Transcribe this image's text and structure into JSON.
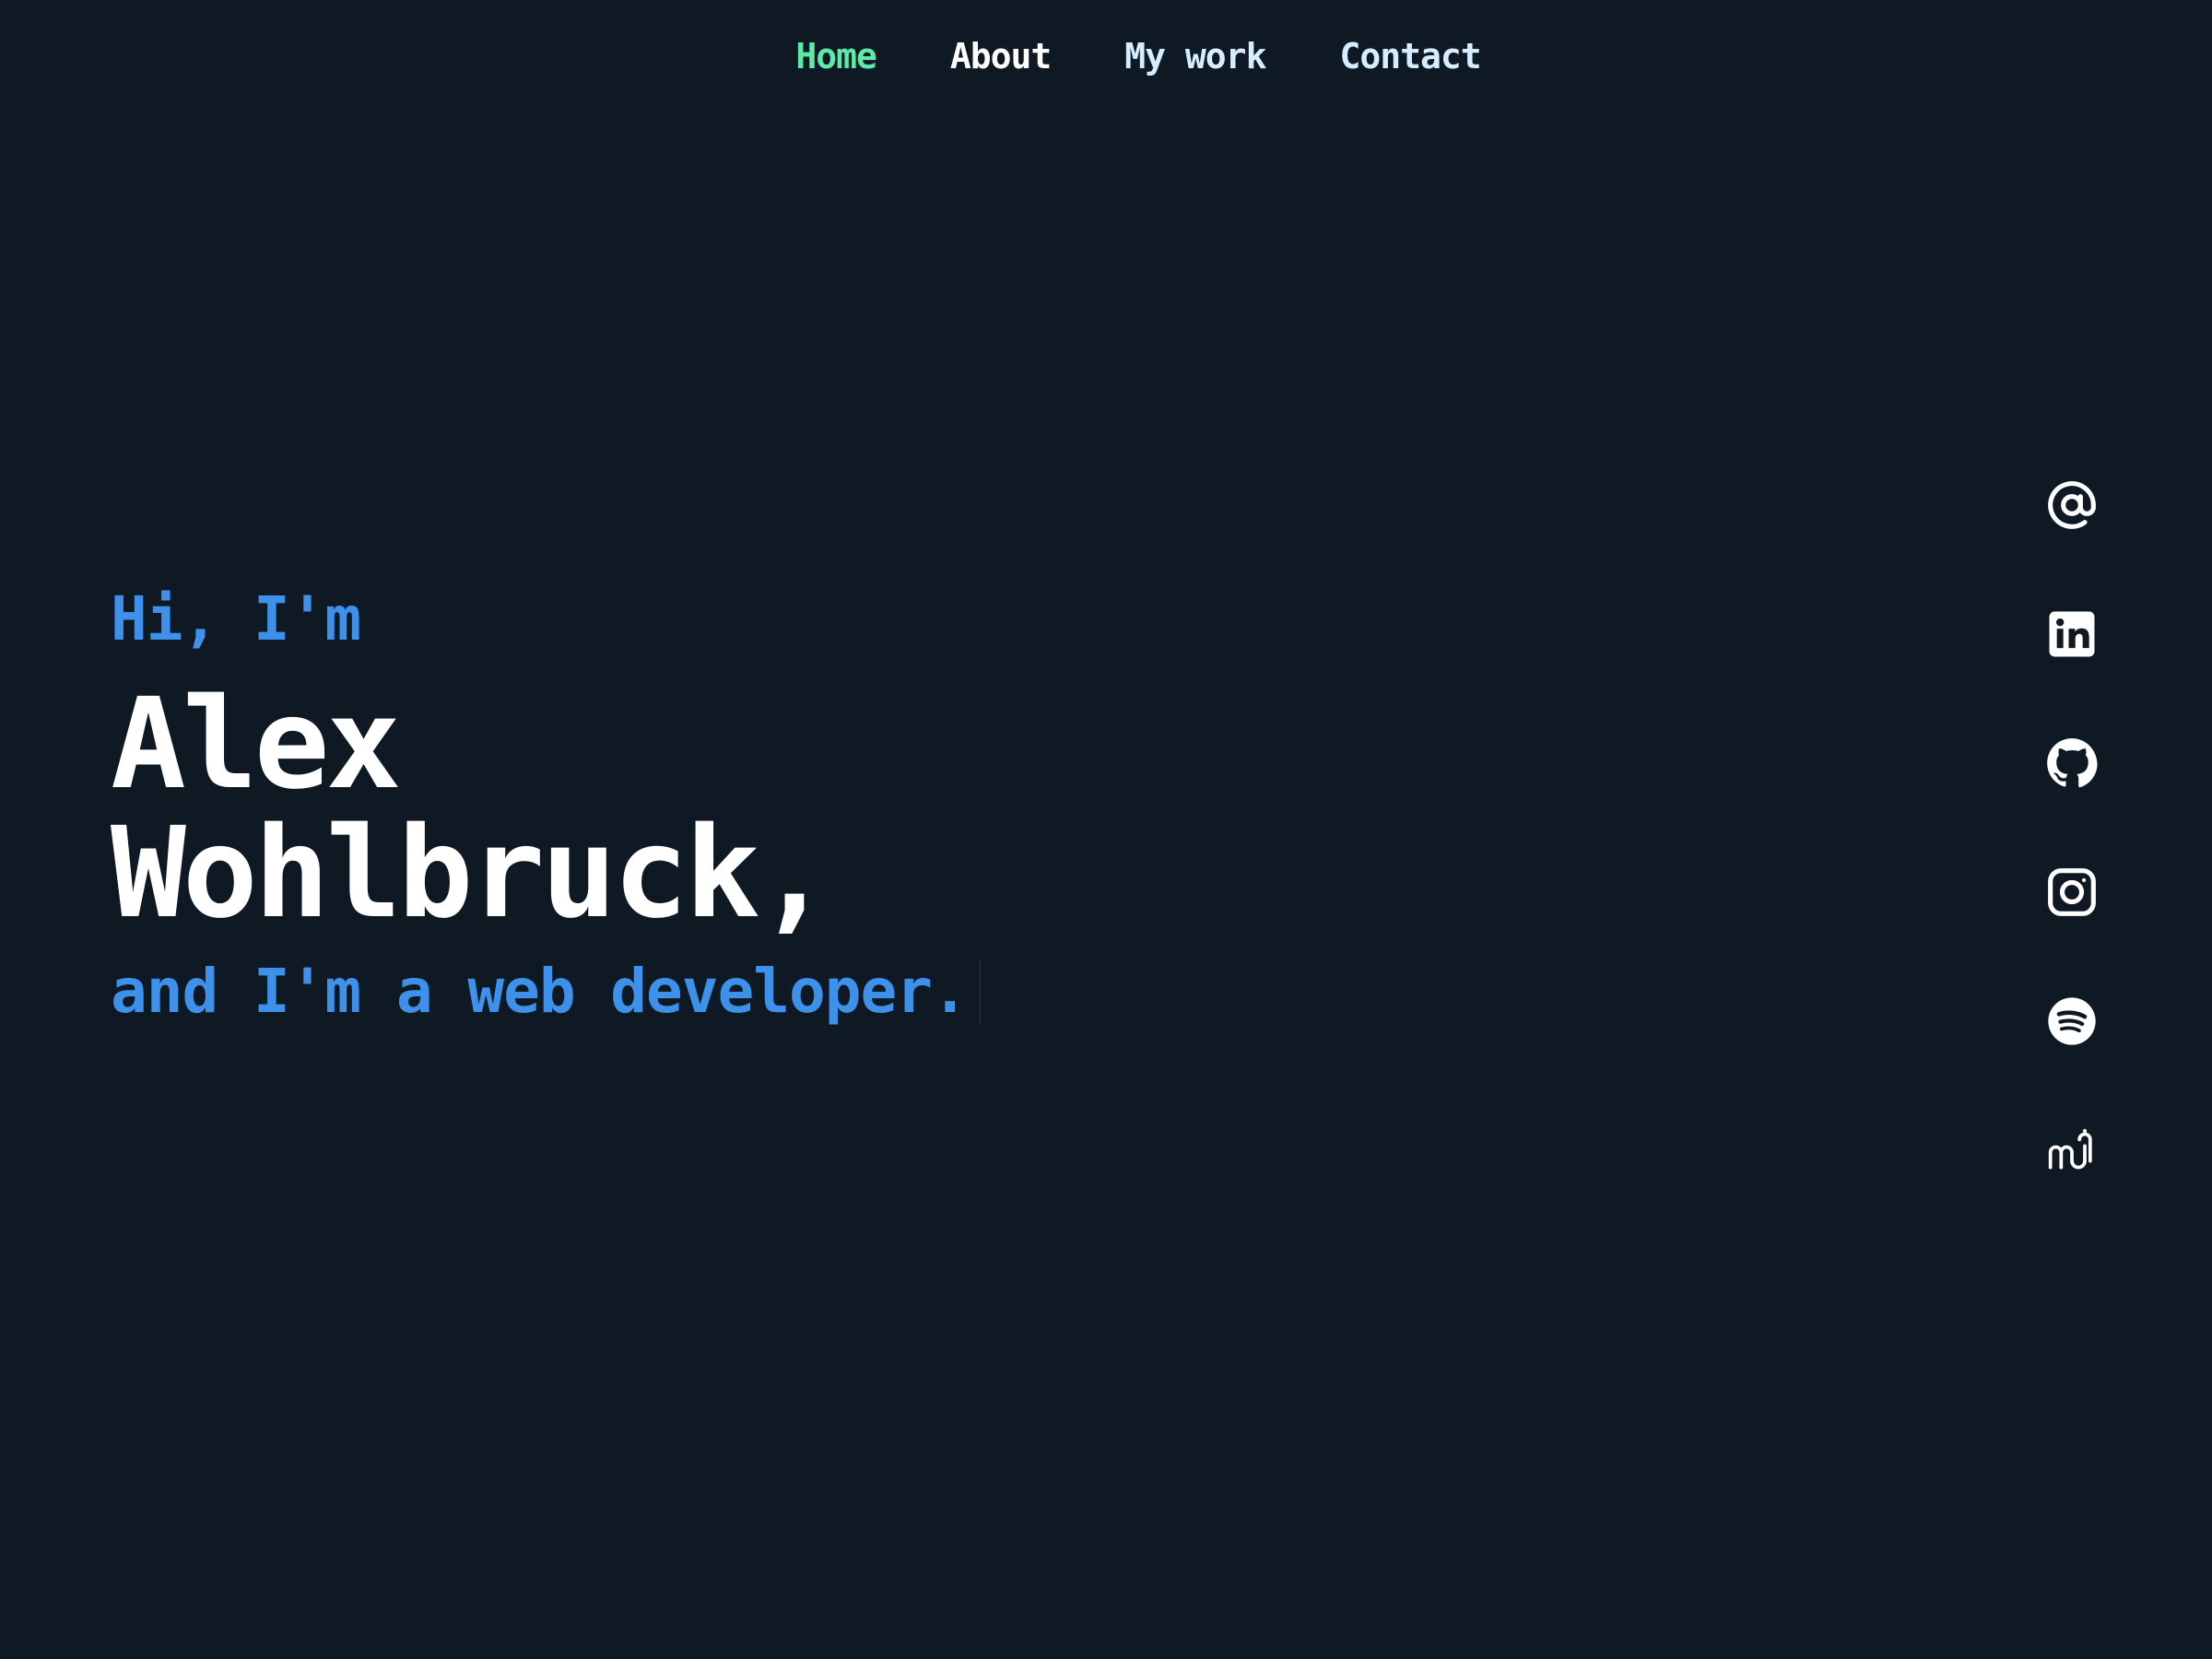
{
  "nav": {
    "items": [
      {
        "label": "Home",
        "active": true
      },
      {
        "label": "About"
      },
      {
        "label": "My work"
      },
      {
        "label": "Contact"
      }
    ]
  },
  "hero": {
    "greeting": "Hi, I'm",
    "name_line1": "Alex",
    "name_line2": "Wohlbruck,",
    "tagline": "and I'm a web developer."
  },
  "social": {
    "icons": [
      "at-sign-icon",
      "linkedin-icon",
      "github-icon",
      "instagram-icon",
      "spotify-icon",
      "memo-logo-icon"
    ]
  },
  "colors": {
    "background": "#0f1923",
    "accent_green": "#5fe8a8",
    "accent_blue": "#3d91ea",
    "text_white": "#ffffff",
    "nav_light": "#d6ecff"
  }
}
